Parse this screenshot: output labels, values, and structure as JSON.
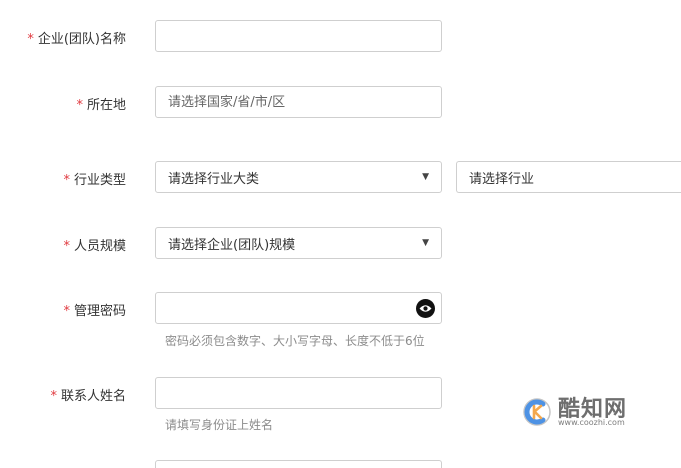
{
  "form": {
    "company_name": {
      "label": "企业(团队)名称",
      "value": ""
    },
    "location": {
      "label": "所在地",
      "placeholder": "请选择国家/省/市/区"
    },
    "industry": {
      "label": "行业类型",
      "category_text": "请选择行业大类",
      "sub_text": "请选择行业"
    },
    "staff_size": {
      "label": "人员规模",
      "text": "请选择企业(团队)规模"
    },
    "password": {
      "label": "管理密码",
      "hint": "密码必须包含数字、大小写字母、长度不低于6位"
    },
    "contact_name": {
      "label": "联系人姓名",
      "hint": "请填写身份证上姓名"
    }
  },
  "required_marker": "*",
  "icons": {
    "password_toggle": "eye-icon",
    "dropdown": "caret-down-icon"
  },
  "watermark": {
    "brand": "酷知网",
    "url": "www.coozhi.com"
  },
  "colors": {
    "required": "#e0383e",
    "border": "#cfcfcf",
    "hint": "#8c8c8c",
    "watermark_accent": "#2f7fe0"
  }
}
